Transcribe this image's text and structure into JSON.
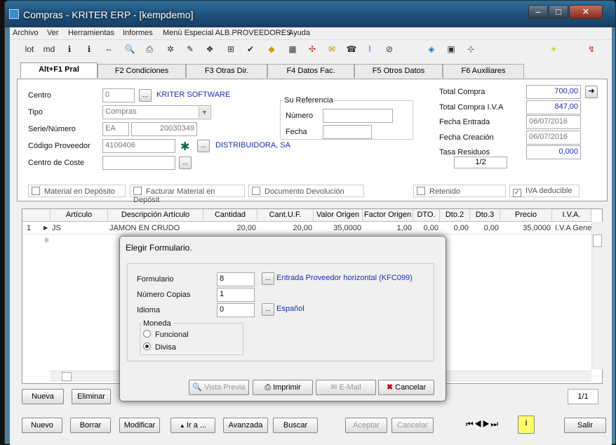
{
  "window": {
    "title": "Compras - KRITER ERP - [kempdemo]"
  },
  "menu": [
    "Archivo",
    "Ver",
    "Herramientas",
    "Informes",
    "Menú Especial ALB.PROVEEDORES",
    "Ayuda"
  ],
  "toolbar": {
    "lot": "lot",
    "md": "md"
  },
  "tabs": [
    "Alt+F1 Pral",
    "F2 Condiciones",
    "F3 Otras Dir.",
    "F4 Datos Fac.",
    "F5 Otros Datos",
    "F6 Auxiliares"
  ],
  "form": {
    "centro_label": "Centro",
    "centro_value": "0",
    "centro_name": "KRITER SOFTWARE",
    "tipo_label": "Tipo",
    "tipo_value": "Compras",
    "serie_label": "Serie/Número",
    "serie_value": "EA",
    "numero_value": "20030349",
    "proveedor_label": "Código Proveedor",
    "proveedor_value": "4100406",
    "proveedor_name": "DISTRIBUIDORA, SA",
    "coste_label": "Centro de Coste",
    "referencia_title": "Su Referencia",
    "ref_numero_label": "Número",
    "ref_fecha_label": "Fecha",
    "total_compra_label": "Total Compra",
    "total_compra": "700,00",
    "total_iva_label": "Total Compra I.V.A",
    "total_iva": "847,00",
    "fecha_entrada_label": "Fecha Entrada",
    "fecha_entrada": "06/07/2016",
    "fecha_creacion_label": "Fecha Creación",
    "fecha_creacion": "06/07/2016",
    "tasa_label": "Tasa Residuos",
    "tasa": "0,000",
    "page": "1/2"
  },
  "checks": [
    "Material en Depósito",
    "Facturar Material en Depósit",
    "Documento Devolución",
    "Retenido",
    "IVA deducible"
  ],
  "grid": {
    "headers": [
      "Artículo",
      "Descripción Artículo",
      "Cantidad",
      "Cant.U.F.",
      "Valor Origen",
      "Factor Origen",
      "DTO.",
      "Dto.2",
      "Dto.3",
      "Precio",
      "I.V.A."
    ],
    "row": [
      "1",
      "JS",
      "JAMON EN CRUDO",
      "20,00",
      "20,00",
      "35,0000",
      "1,00",
      "0,00",
      "0,00",
      "0,00",
      "35,0000",
      "I.V.A Gene"
    ]
  },
  "grid_buttons": {
    "nueva": "Nueva",
    "eliminar": "Eliminar",
    "page": "1/1"
  },
  "bottom_buttons": {
    "nuevo": "Nuevo",
    "borrar": "Borrar",
    "modificar": "Modificar",
    "ira": "Ir a ...",
    "avanzada": "Avanzada",
    "buscar": "Buscar",
    "aceptar": "Aceptar",
    "cancelar": "Cancelar",
    "salir": "Salir"
  },
  "dialog": {
    "title": "Elegir Formulario.",
    "formulario_label": "Formulario",
    "formulario_value": "8",
    "formulario_name": "Entrada Proveedor horizontal (KFC099)",
    "copias_label": "Número Copias",
    "copias_value": "1",
    "idioma_label": "Idioma",
    "idioma_value": "0",
    "idioma_name": "Español",
    "moneda_label": "Moneda",
    "funcional": "Funcional",
    "divisa": "Divisa",
    "vista_previa": "Vista Previa",
    "imprimir": "Imprimir",
    "email": "E-Mail",
    "cancelar": "Cancelar"
  }
}
